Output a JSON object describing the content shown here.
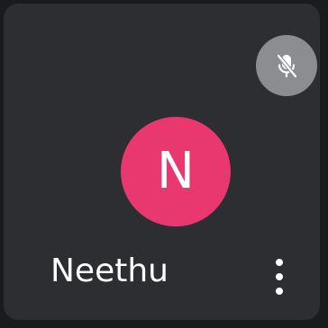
{
  "participant": {
    "name": "Neethu",
    "initial": "N",
    "avatar_color": "#e8386f",
    "microphone": "muted"
  },
  "icons": {
    "mute_indicator": "microphone-off-icon",
    "more_options": "more-vertical-icon"
  },
  "colors": {
    "tile_background": "#2d2e31",
    "page_background": "#1a1b1d",
    "mute_indicator_background": "#8b8d91",
    "text": "#ffffff"
  }
}
